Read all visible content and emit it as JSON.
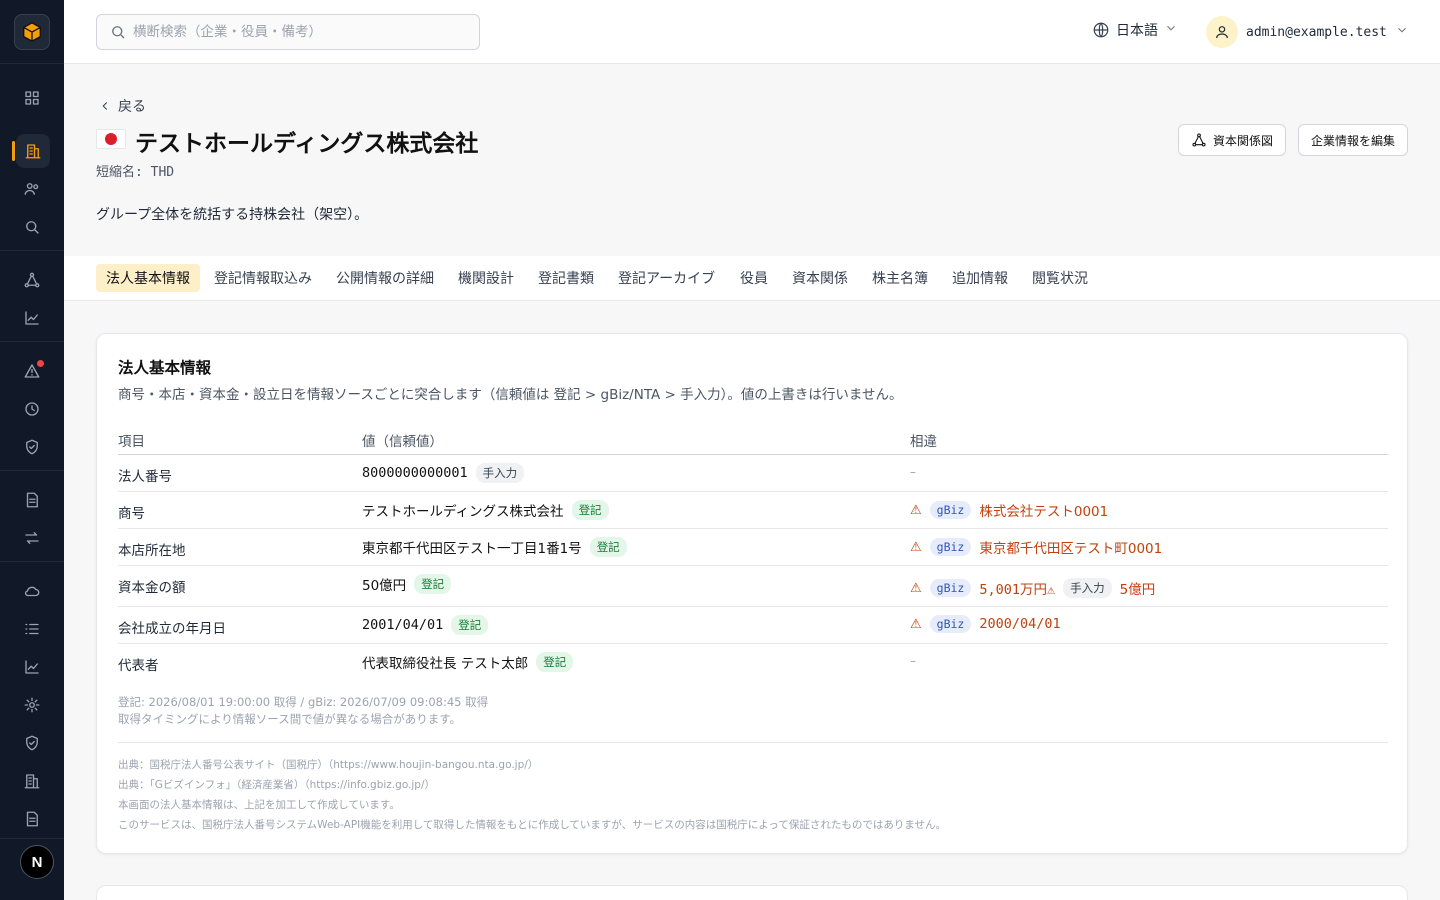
{
  "search": {
    "placeholder": "横断検索（企業・役員・備考）"
  },
  "topbar": {
    "language": "日本語",
    "user_email": "admin@example.test"
  },
  "header": {
    "back_label": "戻る",
    "company_name": "テストホールディングス株式会社",
    "short_name": "短縮名: THD",
    "description": "グループ全体を統括する持株会社（架空）。",
    "capital_diagram_button": "資本関係図",
    "edit_button": "企業情報を編集"
  },
  "tabs": [
    {
      "label": "法人基本情報",
      "active": true
    },
    {
      "label": "登記情報取込み"
    },
    {
      "label": "公開情報の詳細"
    },
    {
      "label": "機関設計"
    },
    {
      "label": "登記書類"
    },
    {
      "label": "登記アーカイブ"
    },
    {
      "label": "役員"
    },
    {
      "label": "資本関係"
    },
    {
      "label": "株主名簿"
    },
    {
      "label": "追加情報"
    },
    {
      "label": "閲覧状況"
    }
  ],
  "card": {
    "title": "法人基本情報",
    "subtitle": "商号・本店・資本金・設立日を情報ソースごとに突合します（信頼値は 登記 > gBiz/NTA > 手入力）。値の上書きは行いません。",
    "columns": {
      "item": "項目",
      "value": "値（信頼値）",
      "diff": "相違"
    },
    "rows": [
      {
        "item": "法人番号",
        "value": "8000000000001",
        "source": "手入力",
        "diff": "–"
      },
      {
        "item": "商号",
        "value": "テストホールディングス株式会社",
        "source": "登記",
        "diff_source": "gBiz",
        "diff_value": "株式会社テスト0001"
      },
      {
        "item": "本店所在地",
        "value": "東京都千代田区テスト一丁目1番1号",
        "source": "登記",
        "diff_source": "gBiz",
        "diff_value": "東京都千代田区テスト町0001"
      },
      {
        "item": "資本金の額",
        "value": "50億円",
        "source": "登記",
        "diff_source": "gBiz",
        "diff_value": "5,001万円⚠",
        "diff_source2": "手入力",
        "diff_value2": "5億円"
      },
      {
        "item": "会社成立の年月日",
        "value": "2001/04/01",
        "source": "登記",
        "diff_source": "gBiz",
        "diff_value": "2000/04/01"
      },
      {
        "item": "代表者",
        "value": "代表取締役社長 テスト太郎",
        "source": "登記",
        "diff": "–"
      }
    ],
    "warn_symbol": "⚠",
    "fetch_note": "登記: 2026/08/01 19:00:00 取得 / gBiz: 2026/07/09 09:08:45 取得",
    "fetch_note2": "取得タイミングにより情報ソース間で値が異なる場合があります。",
    "sources": [
      "出典：国税庁法人番号公表サイト（国税庁）（https://www.houjin-bangou.nta.go.jp/）",
      "出典：「Gビズインフォ」（経済産業省）（https://info.gbiz.go.jp/）",
      "本画面の法人基本情報は、上記を加工して作成しています。",
      "このサービスは、国税庁法人番号システムWeb-API機能を利用して取得した情報をもとに作成していますが、サービスの内容は国税庁によって保証されたものではありません。"
    ]
  },
  "colors": {
    "accent": "#f59e0b",
    "sidebar": "#111827",
    "tab_active": "#fdefc8",
    "warning": "#c2410c"
  }
}
